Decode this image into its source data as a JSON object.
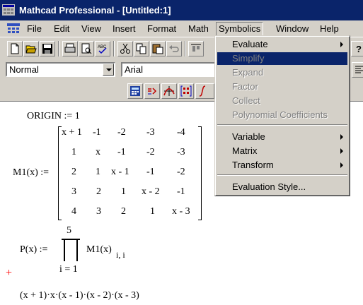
{
  "window": {
    "title": "Mathcad Professional - [Untitled:1]"
  },
  "menubar": {
    "items": [
      {
        "label": "File"
      },
      {
        "label": "Edit"
      },
      {
        "label": "View"
      },
      {
        "label": "Insert"
      },
      {
        "label": "Format"
      },
      {
        "label": "Math"
      },
      {
        "label": "Symbolics"
      },
      {
        "label": "Window"
      },
      {
        "label": "Help"
      }
    ],
    "open_menu": "Symbolics"
  },
  "format_toolbar": {
    "style_value": "Normal",
    "font_value": "Arial"
  },
  "symbolics_menu": {
    "items": [
      {
        "label": "Evaluate",
        "submenu": true,
        "enabled": true
      },
      {
        "label": "Simplify",
        "submenu": false,
        "enabled": false,
        "highlighted": true
      },
      {
        "label": "Expand",
        "submenu": false,
        "enabled": false
      },
      {
        "label": "Factor",
        "submenu": false,
        "enabled": false
      },
      {
        "label": "Collect",
        "submenu": false,
        "enabled": false
      },
      {
        "label": "Polynomial Coefficients",
        "submenu": false,
        "enabled": false
      },
      {
        "label": "Variable",
        "submenu": true,
        "enabled": true
      },
      {
        "label": "Matrix",
        "submenu": true,
        "enabled": true
      },
      {
        "label": "Transform",
        "submenu": true,
        "enabled": true
      },
      {
        "label": "Evaluation Style...",
        "submenu": false,
        "enabled": true
      }
    ]
  },
  "worksheet": {
    "origin": "ORIGIN := 1",
    "matrix_def": "M1(x) :=",
    "matrix": [
      [
        "x + 1",
        "-1",
        "-2",
        "-3",
        "-4"
      ],
      [
        "1",
        "x",
        "-1",
        "-2",
        "-3"
      ],
      [
        "2",
        "1",
        "x - 1",
        "-1",
        "-2"
      ],
      [
        "3",
        "2",
        "1",
        "x - 2",
        "-1"
      ],
      [
        "4",
        "3",
        "2",
        "1",
        "x - 3"
      ]
    ],
    "product_def": "P(x) :=",
    "product_upper": "5",
    "product_lower": "i = 1",
    "product_term": "M1(x)",
    "product_subscript": "i, i",
    "result": "(x + 1)·x·(x - 1)·(x - 2)·(x - 3)",
    "cursor": "+"
  },
  "colors": {
    "title_bar": "#0a246a",
    "menu_face": "#d4d0c8",
    "highlight": "#0a246a",
    "cursor": "#ff0000"
  }
}
